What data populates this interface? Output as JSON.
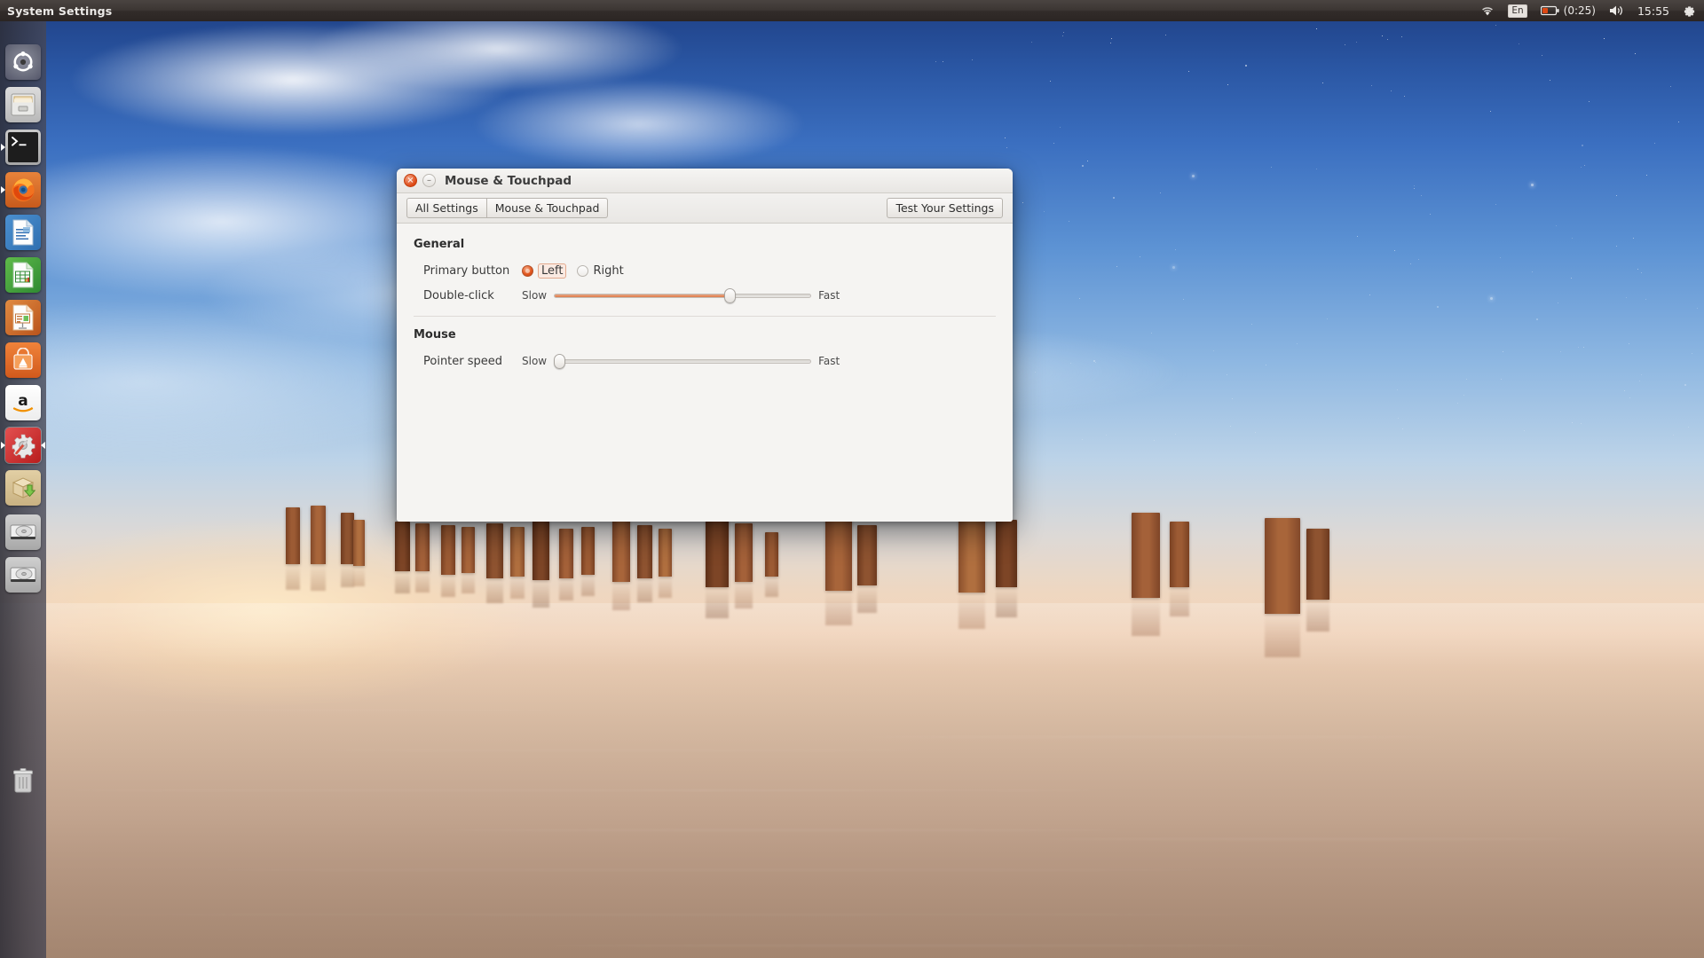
{
  "panel": {
    "app_name": "System Settings",
    "indicators": {
      "wifi": "wifi-icon",
      "keyboard_layout": "En",
      "battery": "(0:25)",
      "volume": "volume-icon",
      "clock": "15:55",
      "session_menu": "gear-icon"
    }
  },
  "launcher": {
    "items": [
      {
        "name": "ubuntu-dash",
        "label": "Dash home",
        "active": false,
        "running": false
      },
      {
        "name": "files",
        "label": "Files",
        "active": false,
        "running": false
      },
      {
        "name": "terminal",
        "label": "Terminal",
        "active": false,
        "running": true
      },
      {
        "name": "firefox",
        "label": "Firefox Web Browser",
        "active": false,
        "running": true
      },
      {
        "name": "libreoffice-writer",
        "label": "LibreOffice Writer",
        "active": false,
        "running": false
      },
      {
        "name": "libreoffice-calc",
        "label": "LibreOffice Calc",
        "active": false,
        "running": false
      },
      {
        "name": "libreoffice-impress",
        "label": "LibreOffice Impress",
        "active": false,
        "running": false
      },
      {
        "name": "software-center",
        "label": "Ubuntu Software Center",
        "active": false,
        "running": false
      },
      {
        "name": "amazon",
        "label": "Amazon",
        "active": false,
        "running": false
      },
      {
        "name": "system-settings",
        "label": "System Settings",
        "active": true,
        "running": true
      },
      {
        "name": "software-updater",
        "label": "Software Updater",
        "active": false,
        "running": false
      },
      {
        "name": "disk-volume-1",
        "label": "Disk volume",
        "active": false,
        "running": false
      },
      {
        "name": "disk-volume-2",
        "label": "Disk volume",
        "active": false,
        "running": false
      },
      {
        "name": "trash",
        "label": "Trash",
        "active": false,
        "running": false
      }
    ]
  },
  "window": {
    "title": "Mouse & Touchpad",
    "close_glyph": "×",
    "minimize_glyph": "–",
    "toolbar": {
      "all_settings": "All Settings",
      "current_panel": "Mouse & Touchpad",
      "test_settings": "Test Your Settings"
    },
    "sections": [
      {
        "title": "General",
        "rows": [
          {
            "type": "radio",
            "label": "Primary button",
            "options": [
              {
                "label": "Left",
                "selected": true,
                "focused": true
              },
              {
                "label": "Right",
                "selected": false,
                "focused": false
              }
            ]
          },
          {
            "type": "slider",
            "label": "Double-click",
            "min_label": "Slow",
            "max_label": "Fast",
            "value_percent": 68
          }
        ]
      },
      {
        "title": "Mouse",
        "rows": [
          {
            "type": "slider",
            "label": "Pointer speed",
            "min_label": "Slow",
            "max_label": "Fast",
            "value_percent": 2
          }
        ]
      }
    ]
  },
  "colors": {
    "accent": "#dd4814",
    "panel_bg": "#3c3633",
    "window_bg": "#f5f4f2",
    "slider_fill": "#dd7b4a"
  }
}
